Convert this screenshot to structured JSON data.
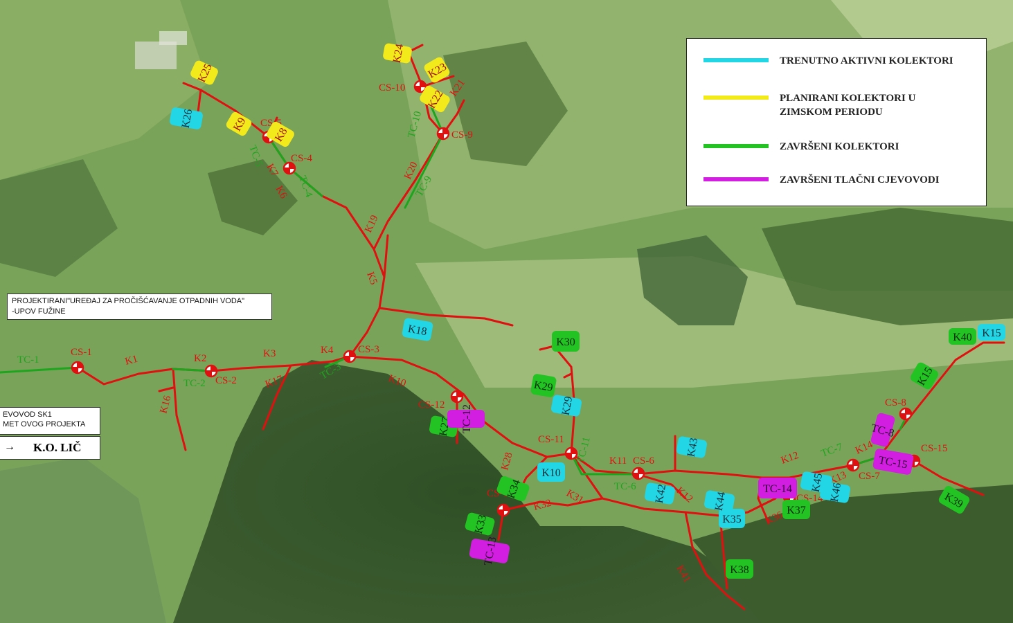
{
  "colors": {
    "active": "#22d6e6",
    "planned": "#f2ea1a",
    "finished_collector": "#22c322",
    "finished_pressure": "#d21ee0",
    "sewer": "#e01010",
    "pressure_line": "#1ea51e"
  },
  "legend": {
    "items": [
      {
        "label": "TRENUTNO AKTIVNI KOLEKTORI",
        "color": "#22d6e6"
      },
      {
        "label": "PLANIRANI KOLEKTORI U\nZIMSKOM PERIODU",
        "color": "#f2ea1a"
      },
      {
        "label": "ZAVRŠENI KOLEKTORI",
        "color": "#22c322"
      },
      {
        "label": "ZAVRŠENI TLAČNI CJEVOVODI",
        "color": "#d21ee0"
      }
    ]
  },
  "notes": {
    "upov_line1": "PROJEKTIRANI\"UREĐAJ ZA PROČIŠĆAVANJE OTPADNIH VODA\"",
    "upov_line2": "-UPOV FUŽINE",
    "sk1_line1": "EVOVOD SK1",
    "sk1_line2": "MET OVOG PROJEKTA",
    "ko_lic": "K.O. LIČ",
    "ko_arrow": "→"
  },
  "stations": [
    "CS-1",
    "CS-2",
    "CS-3",
    "CS-4",
    "CS-5",
    "CS-6",
    "CS-7",
    "CS-8",
    "CS-9",
    "CS-10",
    "CS-11",
    "CS-12",
    "CS-13",
    "CS-14",
    "CS-15"
  ],
  "pressure_lines": [
    "TC-1",
    "TC-2",
    "TC-3",
    "TC-4",
    "TC-5",
    "TC-6",
    "TC-7",
    "TC-8",
    "TC-9",
    "TC-10",
    "TC-11",
    "TC-12",
    "TC-13",
    "TC-14",
    "TC-15"
  ],
  "collector_labels": {
    "plain": [
      "K1",
      "K2",
      "K3",
      "K4",
      "K5",
      "K6",
      "K7",
      "K10",
      "K11",
      "K12",
      "K13",
      "K14",
      "K16",
      "K17",
      "K19",
      "K20",
      "K21",
      "K28",
      "K31",
      "K32",
      "K36",
      "K41",
      "K12"
    ],
    "active": [
      "K10",
      "K18",
      "K26",
      "K29",
      "K35",
      "K38",
      "K42",
      "K43",
      "K44",
      "K45",
      "K46",
      "K15",
      "K40"
    ],
    "planned": [
      "K8",
      "K9",
      "K22",
      "K23",
      "K24",
      "K25"
    ],
    "finished": [
      "K15",
      "K27",
      "K29",
      "K30",
      "K33",
      "K34",
      "K37",
      "K38",
      "K39",
      "K40"
    ],
    "pressure_done": [
      "TC-8",
      "TC-12",
      "TC-13",
      "TC-14",
      "TC-15"
    ]
  }
}
